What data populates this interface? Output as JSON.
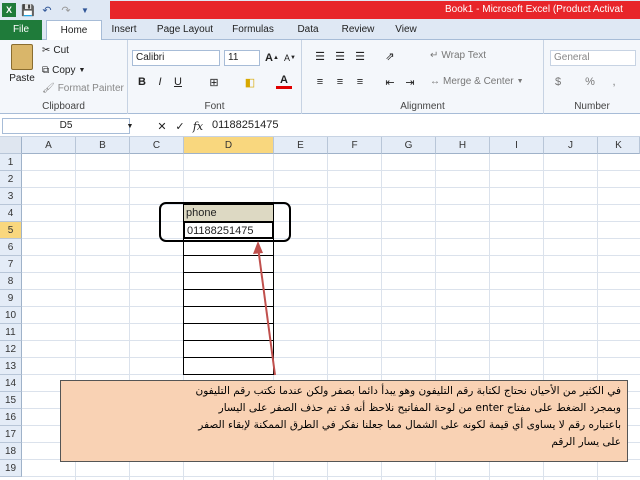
{
  "titlebar": {
    "title": "Book1 - Microsoft Excel (Product Activat"
  },
  "tabs": [
    "File",
    "Home",
    "Insert",
    "Page Layout",
    "Formulas",
    "Data",
    "Review",
    "View"
  ],
  "clipboard": {
    "paste": "Paste",
    "cut": "Cut",
    "copy": "Copy",
    "format_painter": "Format Painter",
    "label": "Clipboard"
  },
  "font": {
    "name": "Calibri",
    "size": "11",
    "bold": "B",
    "italic": "I",
    "underline": "U",
    "label": "Font"
  },
  "alignment": {
    "wrap": "Wrap Text",
    "merge": "Merge & Center",
    "label": "Alignment"
  },
  "number": {
    "format": "General",
    "label": "Number"
  },
  "formula_bar": {
    "name_box": "D5",
    "fx": "fx",
    "value": "01188251475"
  },
  "columns": [
    "A",
    "B",
    "C",
    "D",
    "E",
    "F",
    "G",
    "H",
    "I",
    "J",
    "K"
  ],
  "rows": [
    "1",
    "2",
    "3",
    "4",
    "5",
    "6",
    "7",
    "8",
    "9",
    "10",
    "11",
    "12",
    "13",
    "14",
    "15",
    "16",
    "17",
    "18",
    "19"
  ],
  "cells": {
    "D4": "phone",
    "D5": "01188251475"
  },
  "note": {
    "line1": "في الكثير من الأحيان نحتاج لكتابة رقم التليفون وهو يبدأ دائما بصفر ولكن عندما نكتب رقم التليفون",
    "line2": "وبمجرد الضغط على مفتاح enter من لوحة المفاتيح نلاحظ أنه قد تم حذف الصفر على اليسار",
    "line3": "باعتباره رقم لا يساوى أي قيمة لكونه على الشمال مما جعلنا نفكر في الطرق الممكنة لإبقاء الصفر",
    "line4": "على يسار الرقم"
  },
  "colors": {
    "file_tab": "#1f7b3a",
    "title_red": "#e8252a",
    "header_fill": "#ddd9c3",
    "note_fill": "#f9d2b4",
    "arrow": "#c0504d"
  }
}
